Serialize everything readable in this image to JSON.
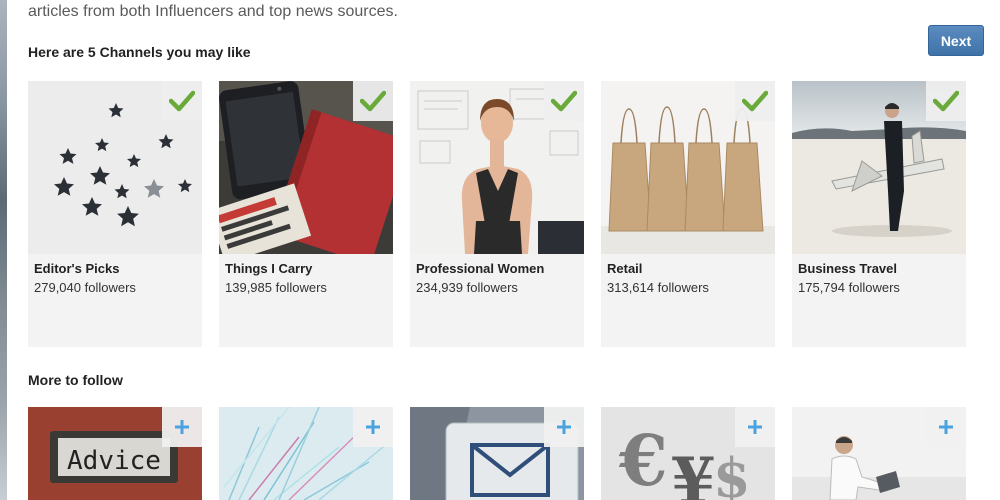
{
  "intro_text": "articles from both Influencers and top news sources.",
  "next_label": "Next",
  "channels_title": "Here are 5 Channels you may like",
  "channels": [
    {
      "name": "Editor's Picks",
      "followers": "279,040 followers",
      "selected": true
    },
    {
      "name": "Things I Carry",
      "followers": "139,985 followers",
      "selected": true
    },
    {
      "name": "Professional Women",
      "followers": "234,939 followers",
      "selected": true
    },
    {
      "name": "Retail",
      "followers": "313,614 followers",
      "selected": true
    },
    {
      "name": "Business Travel",
      "followers": "175,794 followers",
      "selected": true
    }
  ],
  "more_title": "More to follow",
  "more": [
    {
      "sign_text": "Advice"
    },
    {
      "image": "light-fibers"
    },
    {
      "image": "mail-key"
    },
    {
      "image": "currency-symbols"
    },
    {
      "image": "man-with-laptop"
    }
  ],
  "colors": {
    "accent": "#4a7fb5",
    "check": "#6aaa3a",
    "plus": "#4aa3df"
  }
}
